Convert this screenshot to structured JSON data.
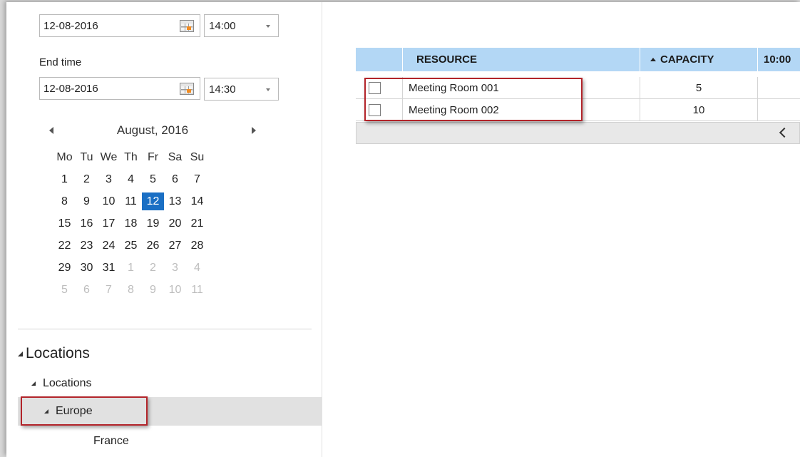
{
  "start": {
    "date": "12-08-2016",
    "time": "14:00"
  },
  "end": {
    "label": "End time",
    "date": "12-08-2016",
    "time": "14:30"
  },
  "calendar": {
    "month_title": "August, 2016",
    "weekdays": [
      "Mo",
      "Tu",
      "We",
      "Th",
      "Fr",
      "Sa",
      "Su"
    ],
    "weeks": [
      [
        {
          "d": "1",
          "o": false
        },
        {
          "d": "2",
          "o": false
        },
        {
          "d": "3",
          "o": false
        },
        {
          "d": "4",
          "o": false
        },
        {
          "d": "5",
          "o": false
        },
        {
          "d": "6",
          "o": false
        },
        {
          "d": "7",
          "o": false
        }
      ],
      [
        {
          "d": "8",
          "o": false
        },
        {
          "d": "9",
          "o": false
        },
        {
          "d": "10",
          "o": false
        },
        {
          "d": "11",
          "o": false
        },
        {
          "d": "12",
          "o": false,
          "sel": true
        },
        {
          "d": "13",
          "o": false
        },
        {
          "d": "14",
          "o": false
        }
      ],
      [
        {
          "d": "15",
          "o": false
        },
        {
          "d": "16",
          "o": false
        },
        {
          "d": "17",
          "o": false
        },
        {
          "d": "18",
          "o": false
        },
        {
          "d": "19",
          "o": false
        },
        {
          "d": "20",
          "o": false
        },
        {
          "d": "21",
          "o": false
        }
      ],
      [
        {
          "d": "22",
          "o": false
        },
        {
          "d": "23",
          "o": false
        },
        {
          "d": "24",
          "o": false
        },
        {
          "d": "25",
          "o": false
        },
        {
          "d": "26",
          "o": false
        },
        {
          "d": "27",
          "o": false
        },
        {
          "d": "28",
          "o": false
        }
      ],
      [
        {
          "d": "29",
          "o": false
        },
        {
          "d": "30",
          "o": false
        },
        {
          "d": "31",
          "o": false
        },
        {
          "d": "1",
          "o": true
        },
        {
          "d": "2",
          "o": true
        },
        {
          "d": "3",
          "o": true
        },
        {
          "d": "4",
          "o": true
        }
      ],
      [
        {
          "d": "5",
          "o": true
        },
        {
          "d": "6",
          "o": true
        },
        {
          "d": "7",
          "o": true
        },
        {
          "d": "8",
          "o": true
        },
        {
          "d": "9",
          "o": true
        },
        {
          "d": "10",
          "o": true
        },
        {
          "d": "11",
          "o": true
        }
      ]
    ]
  },
  "tree": {
    "heading": "Locations",
    "root": "Locations",
    "selected": "Europe",
    "child": "France"
  },
  "grid": {
    "columns": {
      "resource": "RESOURCE",
      "capacity": "CAPACITY",
      "time": "10:00"
    },
    "rows": [
      {
        "resource": "Meeting Room 001",
        "capacity": "5"
      },
      {
        "resource": "Meeting Room 002",
        "capacity": "10"
      }
    ]
  },
  "colors": {
    "selected_day": "#1a6fc4",
    "grid_header": "#b3d7f5",
    "highlight_box": "#b3242a"
  }
}
